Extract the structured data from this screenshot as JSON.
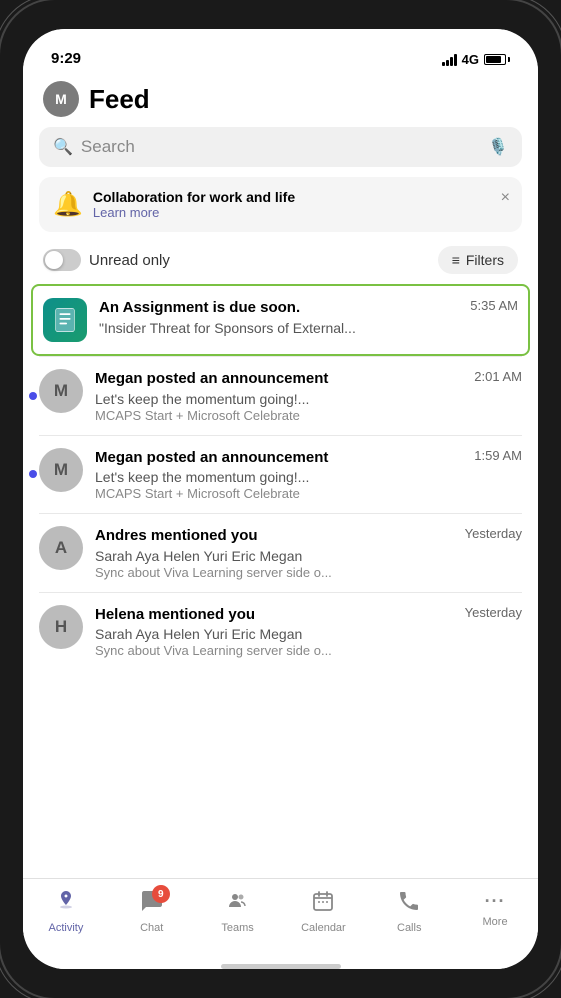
{
  "status_bar": {
    "time": "9:29",
    "network": "4G"
  },
  "header": {
    "avatar_label": "M",
    "title": "Feed"
  },
  "search": {
    "placeholder": "Search"
  },
  "banner": {
    "icon": "🔔",
    "title": "Collaboration for work and life",
    "link": "Learn more",
    "close": "×"
  },
  "filters": {
    "toggle_label": "Unread only",
    "filter_btn": "Filters"
  },
  "feed_items": [
    {
      "id": "assignment",
      "title": "An Assignment is due soon.",
      "time": "5:35 AM",
      "subtitle": "\"Insider Threat for Sponsors of External...",
      "sub2": "",
      "avatar_type": "icon",
      "avatar_label": "📋",
      "highlighted": true,
      "unread": false
    },
    {
      "id": "megan1",
      "title": "Megan posted an announcement",
      "time": "2:01 AM",
      "subtitle": "Let's keep the momentum going!...",
      "sub2": "MCAPS Start + Microsoft Celebrate",
      "avatar_type": "round",
      "avatar_label": "M",
      "highlighted": false,
      "unread": true
    },
    {
      "id": "megan2",
      "title": "Megan posted an announcement",
      "time": "1:59 AM",
      "subtitle": "Let's keep the momentum going!...",
      "sub2": "MCAPS Start + Microsoft Celebrate",
      "avatar_type": "round",
      "avatar_label": "M",
      "highlighted": false,
      "unread": true
    },
    {
      "id": "andres",
      "title": "Andres mentioned you",
      "time": "Yesterday",
      "subtitle": "Sarah Aya Helen Yuri Eric Megan",
      "sub2": "Sync about Viva Learning server side o...",
      "avatar_type": "round",
      "avatar_label": "A",
      "highlighted": false,
      "unread": false
    },
    {
      "id": "helena",
      "title": "Helena mentioned you",
      "time": "Yesterday",
      "subtitle": "Sarah Aya Helen Yuri Eric Megan",
      "sub2": "Sync about Viva Learning server side o...",
      "avatar_type": "round",
      "avatar_label": "H",
      "highlighted": false,
      "unread": false
    }
  ],
  "tab_bar": {
    "items": [
      {
        "id": "activity",
        "label": "Activity",
        "icon": "🔔",
        "active": true,
        "badge": null
      },
      {
        "id": "chat",
        "label": "Chat",
        "icon": "💬",
        "active": false,
        "badge": "9"
      },
      {
        "id": "teams",
        "label": "Teams",
        "icon": "👥",
        "active": false,
        "badge": null
      },
      {
        "id": "calendar",
        "label": "Calendar",
        "icon": "📅",
        "active": false,
        "badge": null
      },
      {
        "id": "calls",
        "label": "Calls",
        "icon": "📞",
        "active": false,
        "badge": null
      },
      {
        "id": "more",
        "label": "More",
        "icon": "···",
        "active": false,
        "badge": null
      }
    ]
  }
}
